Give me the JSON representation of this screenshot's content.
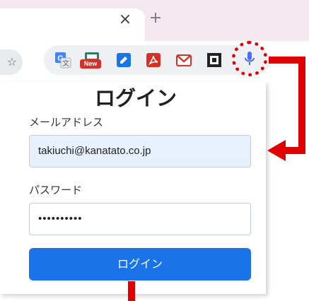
{
  "browser": {
    "tab_close_glyph": "×",
    "new_tab_glyph": "+",
    "bookmark_glyph": "☆",
    "extensions": [
      {
        "icon": "translate-icon",
        "color": "#4285f4"
      },
      {
        "icon": "new-extension-icon",
        "badge": "New",
        "color": "#d93025"
      },
      {
        "icon": "edit-icon",
        "color": "#1a73e8"
      },
      {
        "icon": "pdf-icon",
        "color": "#d93025"
      },
      {
        "icon": "gmail-icon",
        "color": "#d93025"
      },
      {
        "icon": "qr-icon",
        "color": "#222222"
      },
      {
        "icon": "microphone-icon",
        "color": "#4a6cf7"
      }
    ]
  },
  "form": {
    "title": "ログイン",
    "email_label": "メールアドレス",
    "email_value": "takiuchi@kanatato.co.jp",
    "password_label": "パスワード",
    "password_value": "••••••••••",
    "submit_label": "ログイン"
  },
  "annotation": {
    "color": "#e00000"
  }
}
